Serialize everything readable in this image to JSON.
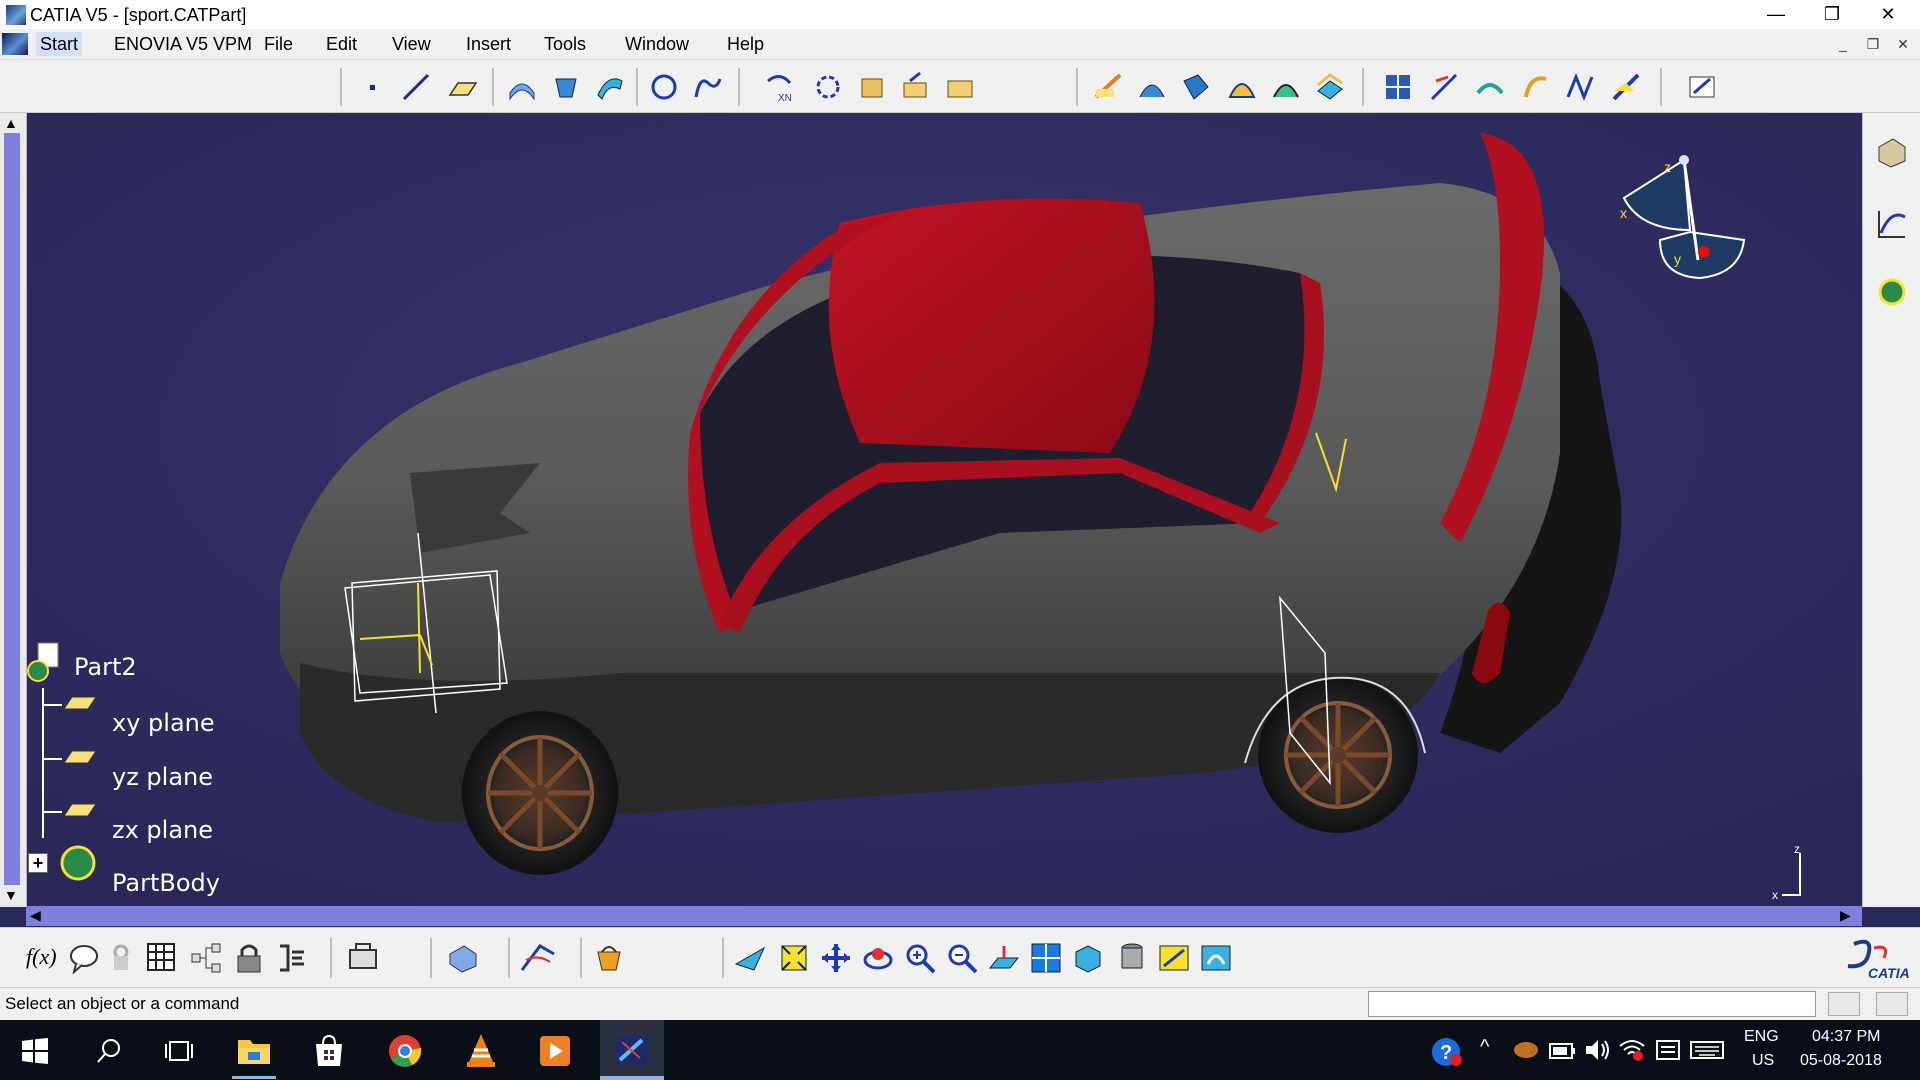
{
  "window": {
    "title": "CATIA V5 - [sport.CATPart]",
    "min": "—",
    "restore": "❐",
    "close": "✕"
  },
  "menu": {
    "items": [
      "Start",
      "ENOVIA V5 VPM",
      "File",
      "Edit",
      "View",
      "Insert",
      "Tools",
      "Window",
      "Help"
    ],
    "mdi_min": "_",
    "mdi_restore": "❐",
    "mdi_close": "✕"
  },
  "tree": {
    "root": "Part2",
    "children": [
      "xy plane",
      "yz plane",
      "zx plane",
      "PartBody"
    ],
    "expand_symbol": "+"
  },
  "compass": {
    "x_label": "x",
    "y_label": "y",
    "z_label": "z"
  },
  "axis_small": {
    "x_label": "x",
    "z_label": "z"
  },
  "bottom_toolbar": {
    "formula_label": "f(x)"
  },
  "brand": {
    "logo_text": "CATIA"
  },
  "status": {
    "message": "Select an object or a command"
  },
  "taskbar": {
    "lang_top": "ENG",
    "lang_bottom": "US",
    "time": "04:37 PM",
    "date": "05-08-2018"
  },
  "colors": {
    "viewport": "#2e2c60",
    "car_body": "#5a5a5a",
    "car_roof": "#b01020",
    "accent_select": "#cfe0f7"
  }
}
